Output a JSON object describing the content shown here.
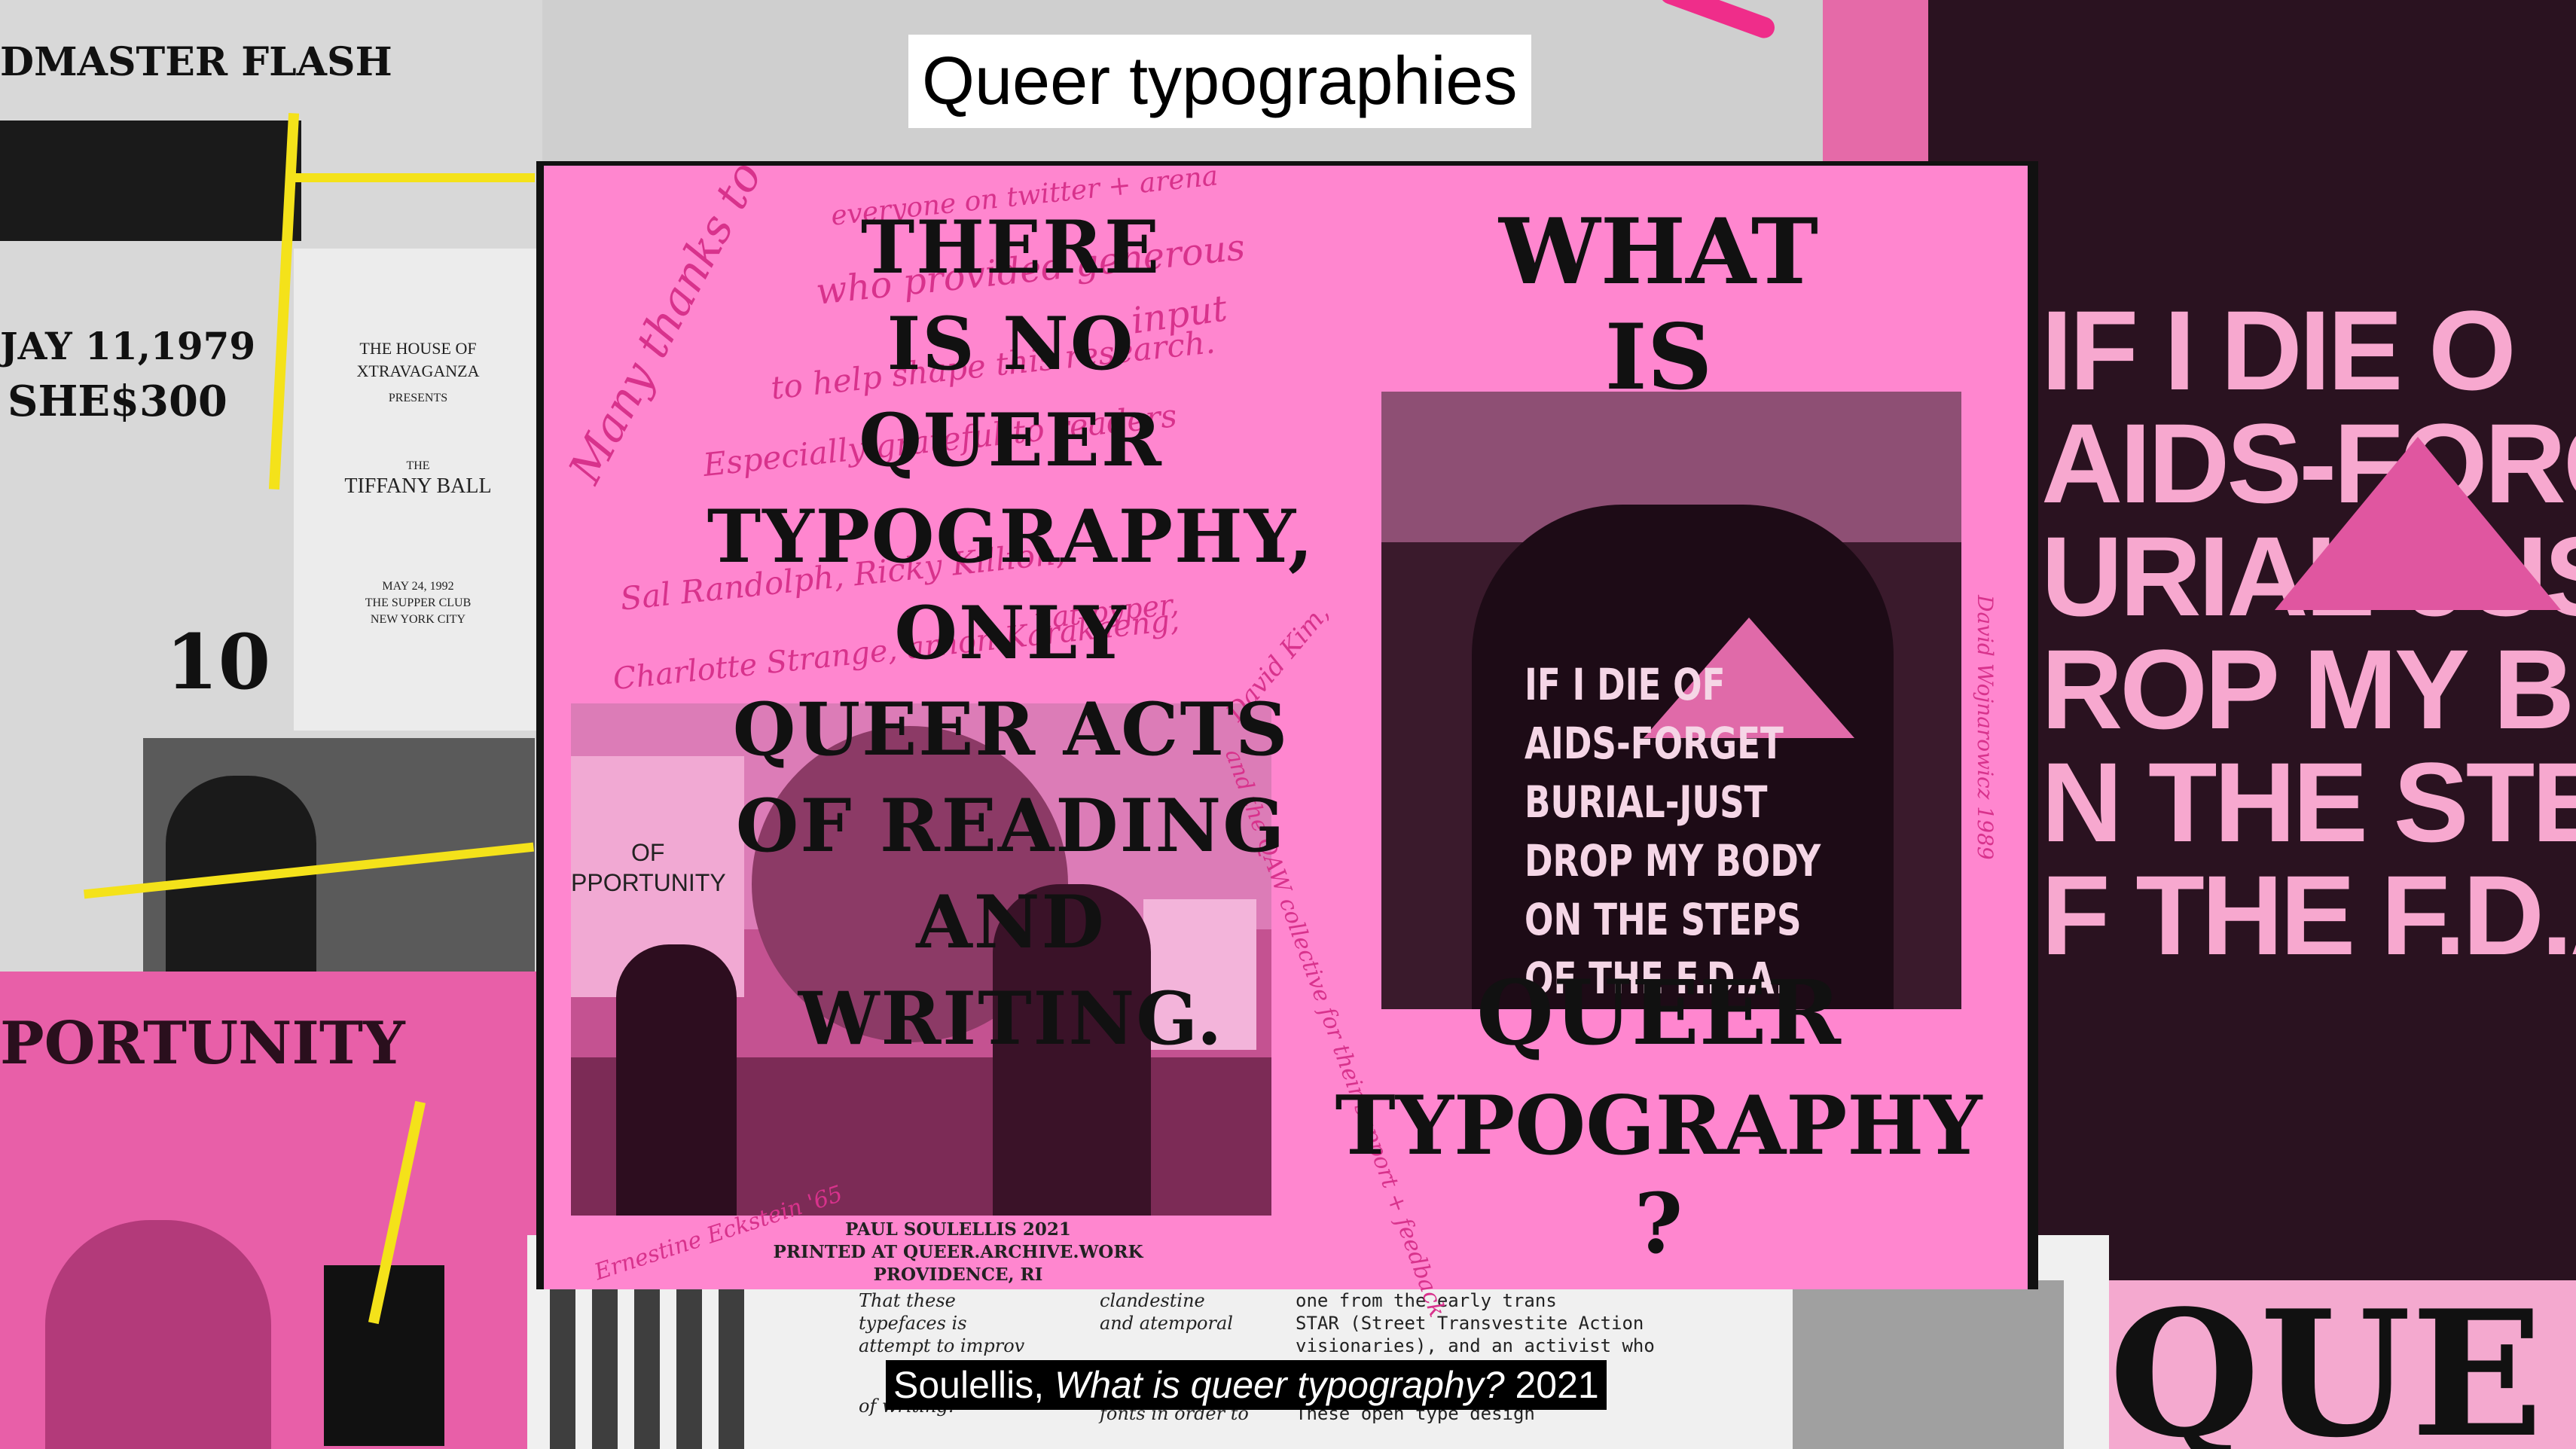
{
  "slide": {
    "title": "Queer typographies",
    "caption_author": "Soulellis, ",
    "caption_work": "What is queer typography?",
    "caption_year": " 2021"
  },
  "zine": {
    "left_heading": [
      "THERE",
      "IS NO",
      "QUEER",
      "TYPOGRAPHY,",
      "ONLY",
      "QUEER ACTS",
      "OF READING",
      "AND",
      "WRITING."
    ],
    "credit": [
      "PAUL SOULELLIS 2021",
      "PRINTED AT QUEER.ARCHIVE.WORK",
      "PROVIDENCE, RI"
    ],
    "right_top": [
      "WHAT",
      "IS"
    ],
    "right_bottom": [
      "QUEER",
      "TYPOGRAPHY",
      "?"
    ],
    "jacket_text": [
      "IF I DIE OF",
      "AIDS-FORGET",
      "BURIAL-JUST",
      "DROP MY BODY",
      "ON THE STEPS",
      "OF THE F.D.A."
    ],
    "sign_left": [
      "OF",
      "PPORTUNITY"
    ],
    "handwriting": {
      "line1": "Many thanks to",
      "line2": "everyone on twitter + arena",
      "line3": "who provided generous",
      "line4": "input",
      "line5": "to help shape this research.",
      "line6": "Especially grateful to readers",
      "line7": "Sal Randolph, Ricky Killion,",
      "line8": "nat pyper,",
      "line9": "Charlotte Strange, arnon Karakaeng,",
      "line10": "David Kim,",
      "line11": "and the QAW collective for their support + feedback",
      "line12": "Ernestine Eckstein '65",
      "line13": "David Wojnarowicz 1989"
    }
  },
  "collage": {
    "right_big": [
      "IF I DIE O",
      "AIDS-FORG",
      "URIAL-JUS",
      "ROP MY BO",
      "N THE STEP",
      "F THE F.D.A"
    ],
    "right_bottom": "QUE",
    "left_texts": {
      "a": "DMASTER FLASH",
      "b": "JAY 11,1979",
      "c": "SHE$300",
      "d": "10",
      "e": "PORTUNITY"
    },
    "doc": [
      "THE HOUSE OF",
      "XTRAVAGANZA",
      "PRESENTS",
      "THE",
      "TIFFANY BALL",
      "MAY 24, 1992",
      "THE SUPPER CLUB",
      "NEW YORK CITY"
    ],
    "bottom_text": [
      "That these",
      "typefaces is",
      "attempt to improv",
      "clandestine",
      "and atemporal",
      "one from the early trans",
      "STAR (Street Transvestite Action",
      "visionaries), and an activist who",
      "These open type design",
      "fonts in order to",
      "of writing."
    ]
  },
  "colors": {
    "zine_pink": "#ff86cf",
    "hand_pink": "#d8328c",
    "ink": "#111111",
    "yellow": "#f4e21a"
  }
}
